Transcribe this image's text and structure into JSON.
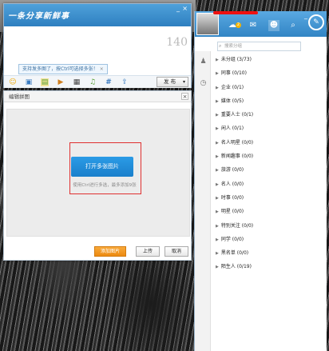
{
  "compose": {
    "logo_text": "一条分享新鲜事",
    "minimize": "_",
    "close": "×",
    "counter": "140",
    "tooltip": "支持发多图了，按Ctrl可选择多张！",
    "tooltip_close": "×",
    "toolbar_icons": [
      "smile-icon",
      "image-icon",
      "multi-image-icon",
      "video-icon",
      "calendar-icon",
      "music-icon",
      "topic-icon",
      "share-icon"
    ],
    "publish_label": "发 布",
    "publish_arrow": "▾"
  },
  "dialog": {
    "title": "编辑拼图",
    "close": "×",
    "open_button": "打开多张图片",
    "hint": "使用Ctrl进行多选，最多添加9张",
    "add_button": "添加图片",
    "upload_button": "上传",
    "cancel_button": "取消"
  },
  "panel": {
    "minimize": "_",
    "close": "×",
    "badge": "2",
    "search_placeholder": "搜索分组",
    "groups": [
      "未分组 (3/73)",
      "同事 (0/10)",
      "企业 (0/1)",
      "媒体 (0/5)",
      "重要人士 (0/1)",
      "闲人 (0/1)",
      "名人明星 (0/0)",
      "新闻趣事 (0/0)",
      "旅游 (0/0)",
      "名人 (0/0)",
      "时事 (0/0)",
      "明星 (0/0)",
      "特别关注 (0/0)",
      "同学 (0/0)",
      "黑名单 (0/0)",
      "陌生人 (0/19)"
    ]
  }
}
